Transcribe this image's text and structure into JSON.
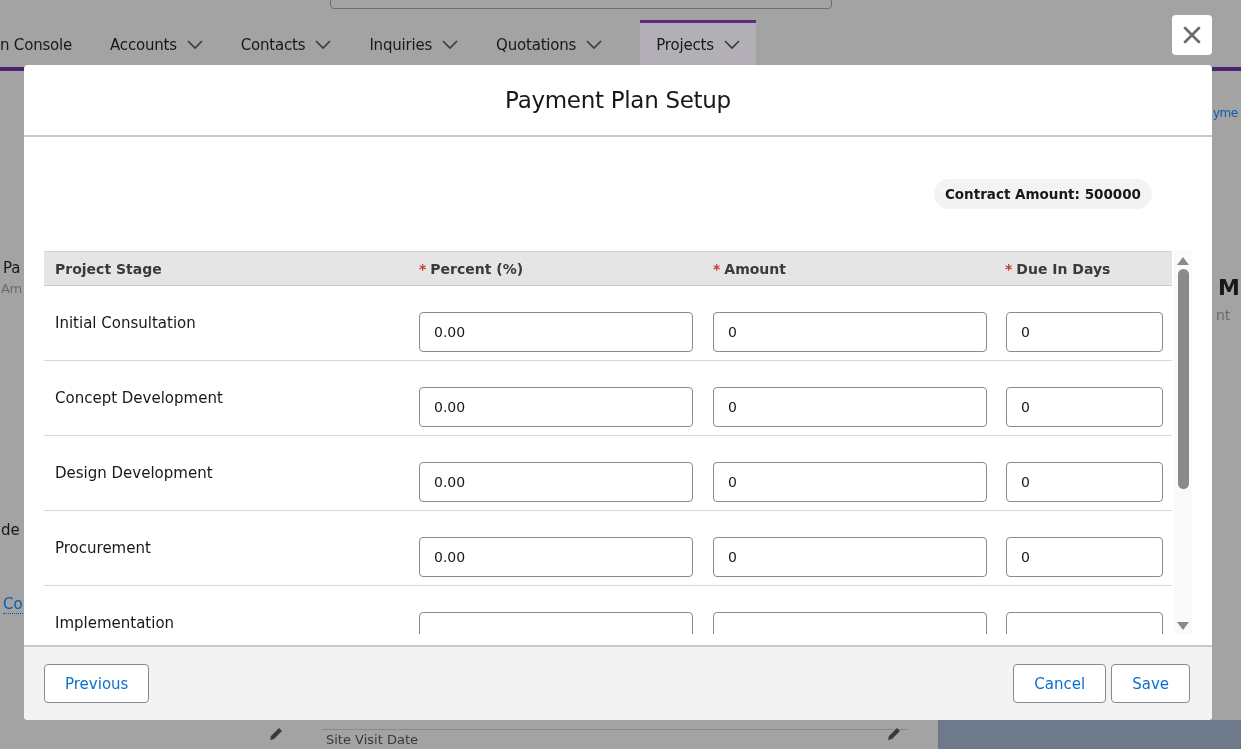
{
  "background": {
    "nav_tabs": [
      {
        "label": "n Console",
        "has_menu": false,
        "selected": false
      },
      {
        "label": "Accounts",
        "has_menu": true,
        "selected": false
      },
      {
        "label": "Contacts",
        "has_menu": true,
        "selected": false
      },
      {
        "label": "Inquiries",
        "has_menu": true,
        "selected": false
      },
      {
        "label": "Quotations",
        "has_menu": true,
        "selected": false
      },
      {
        "label": "Projects",
        "has_menu": true,
        "selected": true
      }
    ],
    "left_fragments": [
      "Pa",
      "Am",
      "de",
      "Co"
    ],
    "right_fragments": [
      "yme",
      "M",
      "nt"
    ],
    "bottom_label": "Site Visit Date"
  },
  "modal": {
    "title": "Payment Plan Setup",
    "contract_badge": "Contract Amount: 500000",
    "table": {
      "columns": [
        {
          "label": "Project Stage"
        },
        {
          "label": "Percent (%)",
          "required_mark": "*"
        },
        {
          "label": "Amount",
          "required_mark": "*"
        },
        {
          "label": "Due In Days",
          "required_mark": "*"
        }
      ],
      "rows": [
        {
          "stage": "Initial Consultation",
          "percent": "0.00",
          "amount": "0",
          "due_in_days": "0"
        },
        {
          "stage": "Concept Development",
          "percent": "0.00",
          "amount": "0",
          "due_in_days": "0"
        },
        {
          "stage": "Design Development",
          "percent": "0.00",
          "amount": "0",
          "due_in_days": "0"
        },
        {
          "stage": "Procurement",
          "percent": "0.00",
          "amount": "0",
          "due_in_days": "0"
        },
        {
          "stage": "Implementation",
          "percent": "",
          "amount": "",
          "due_in_days": ""
        }
      ]
    },
    "footer": {
      "left_buttons": [
        "Previous"
      ],
      "right_buttons": [
        "Cancel",
        "Save"
      ]
    }
  }
}
